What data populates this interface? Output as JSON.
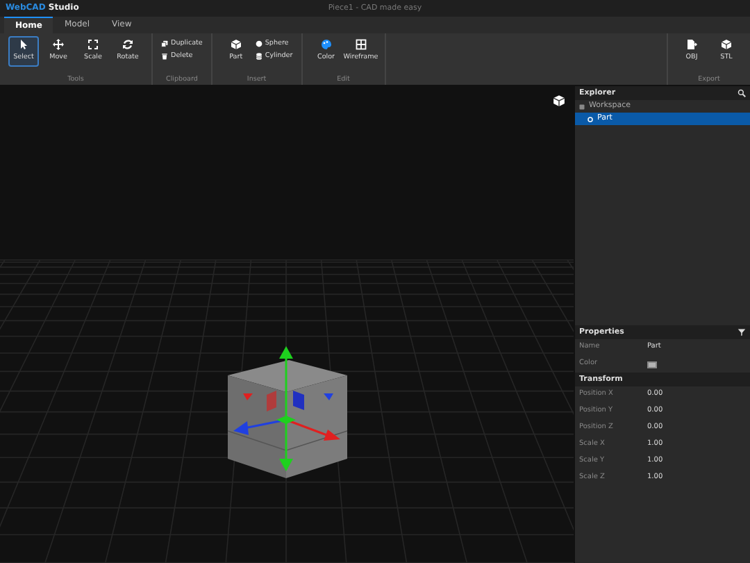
{
  "title_bar": {
    "brand_name": "WebCAD",
    "brand_suffix": "Studio",
    "title": "Piece1 - CAD made easy"
  },
  "tabs": [
    {
      "label": "Home",
      "selected": true
    },
    {
      "label": "Model",
      "selected": false
    },
    {
      "label": "View",
      "selected": false
    }
  ],
  "ribbon": [
    {
      "label": "Tools",
      "items": [
        {
          "kind": "large",
          "label": "Select",
          "selected": true
        },
        {
          "kind": "large",
          "label": "Move",
          "selected": false
        },
        {
          "kind": "large",
          "label": "Scale",
          "selected": false
        },
        {
          "kind": "large",
          "label": "Rotate",
          "selected": false
        }
      ]
    },
    {
      "label": "Clipboard",
      "items": [
        {
          "kind": "small",
          "label": "Duplicate"
        },
        {
          "kind": "small",
          "label": "Delete"
        }
      ]
    },
    {
      "label": "Insert",
      "items": [
        {
          "kind": "large",
          "label": "Part",
          "selected": false
        },
        {
          "kind": "small",
          "label": "Sphere"
        },
        {
          "kind": "small",
          "label": "Cylinder"
        }
      ]
    },
    {
      "label": "Edit",
      "items": [
        {
          "kind": "large",
          "label": "Color",
          "selected": false
        },
        {
          "kind": "large",
          "label": "Wireframe",
          "selected": false
        }
      ]
    },
    {
      "label": "Export",
      "items": [
        {
          "kind": "large",
          "label": "OBJ",
          "selected": false
        },
        {
          "kind": "large",
          "label": "STL",
          "selected": false
        }
      ]
    }
  ],
  "explorer": {
    "title": "Explorer",
    "tree": [
      {
        "label": "Workspace",
        "selected": false,
        "children": [
          {
            "label": "Part",
            "selected": true
          }
        ]
      }
    ]
  },
  "properties": {
    "title": "Properties",
    "rows": [
      {
        "kind": "text",
        "label": "Name",
        "value": "Part"
      },
      {
        "kind": "color",
        "label": "Color",
        "color": "#b4b4b4"
      },
      {
        "kind": "section",
        "label": "Transform"
      },
      {
        "kind": "text",
        "label": "Position X",
        "value": "0.00"
      },
      {
        "kind": "text",
        "label": "Position Y",
        "value": "0.00"
      },
      {
        "kind": "text",
        "label": "Position Z",
        "value": "0.00"
      },
      {
        "kind": "text",
        "label": "Scale X",
        "value": "1.00"
      },
      {
        "kind": "text",
        "label": "Scale Y",
        "value": "1.00"
      },
      {
        "kind": "text",
        "label": "Scale Z",
        "value": "1.00"
      }
    ]
  }
}
